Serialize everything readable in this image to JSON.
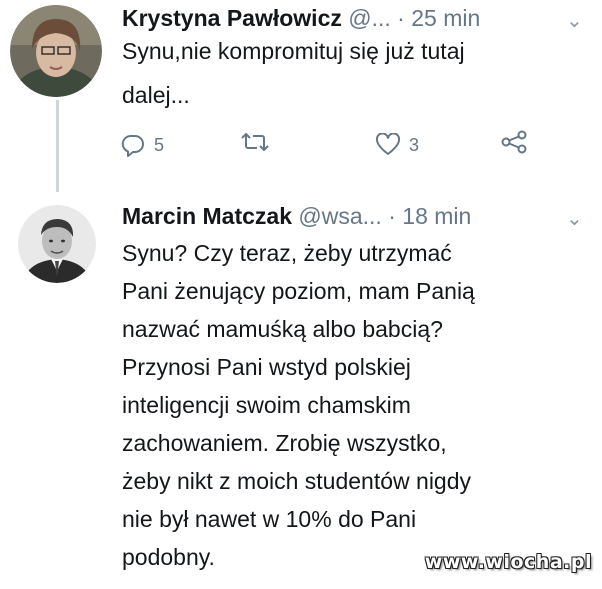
{
  "tweets": [
    {
      "author_name": "Krystyna Pawłowicz",
      "author_handle": "@...",
      "separator": "·",
      "timestamp": "25 min",
      "text": "Synu,nie kompromituj się już tutaj\ndalej...",
      "actions": {
        "reply_count": "5",
        "retweet_count": "",
        "like_count": "3"
      }
    },
    {
      "author_name": "Marcin Matczak",
      "author_handle": "@wsa...",
      "separator": "·",
      "timestamp": "18 min",
      "text": "Synu? Czy teraz, żeby utrzymać\nPani żenujący poziom, mam Panią\nnazwać mamuśką albo babcią?\nPrzynosi Pani wstyd polskiej\ninteligencji swoim chamskim\nzachowaniem. Zrobię wszystko,\nżeby nikt z moich studentów nigdy\nnie był nawet w 10% do Pani\npodobny."
    }
  ],
  "icons": {
    "reply": "reply-icon",
    "retweet": "retweet-icon",
    "like": "heart-icon",
    "share": "share-icon",
    "caret": "chevron-down-icon"
  },
  "caret_glyph": "⌄",
  "watermark": "www.wiocha.pl",
  "colors": {
    "text": "#14171a",
    "muted": "#657786",
    "thread_line": "#ccd6dd"
  }
}
